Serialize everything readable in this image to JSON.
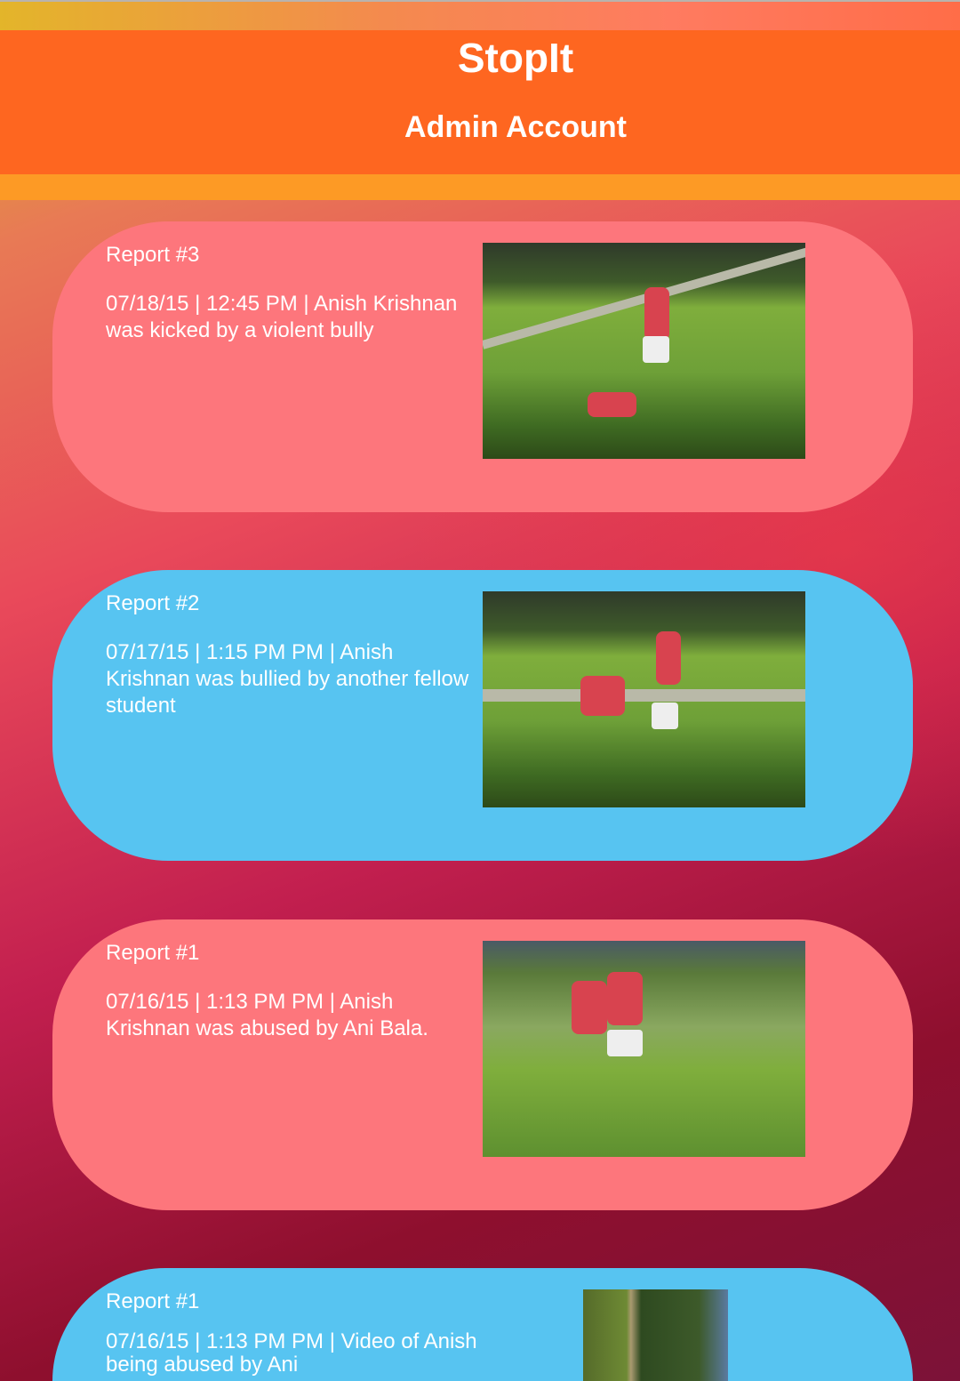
{
  "header": {
    "app_title": "StopIt",
    "subtitle": "Admin Account"
  },
  "reports": [
    {
      "title": "Report #3",
      "description": "07/18/15 | 12:45 PM | Anish Krishnan was kicked by a violent bully",
      "color": "#fd767c"
    },
    {
      "title": "Report #2",
      "description": "07/17/15 | 1:15 PM PM | Anish Krishnan was bullied by another fellow student",
      "color": "#57c4f1"
    },
    {
      "title": "Report #1",
      "description": "07/16/15 | 1:13 PM PM | Anish Krishnan was abused by Ani Bala.",
      "color": "#fd767c"
    },
    {
      "title": "Report #1",
      "description": "07/16/15 | 1:13 PM PM | Video of Anish being abused by Ani",
      "color": "#57c4f1"
    }
  ]
}
